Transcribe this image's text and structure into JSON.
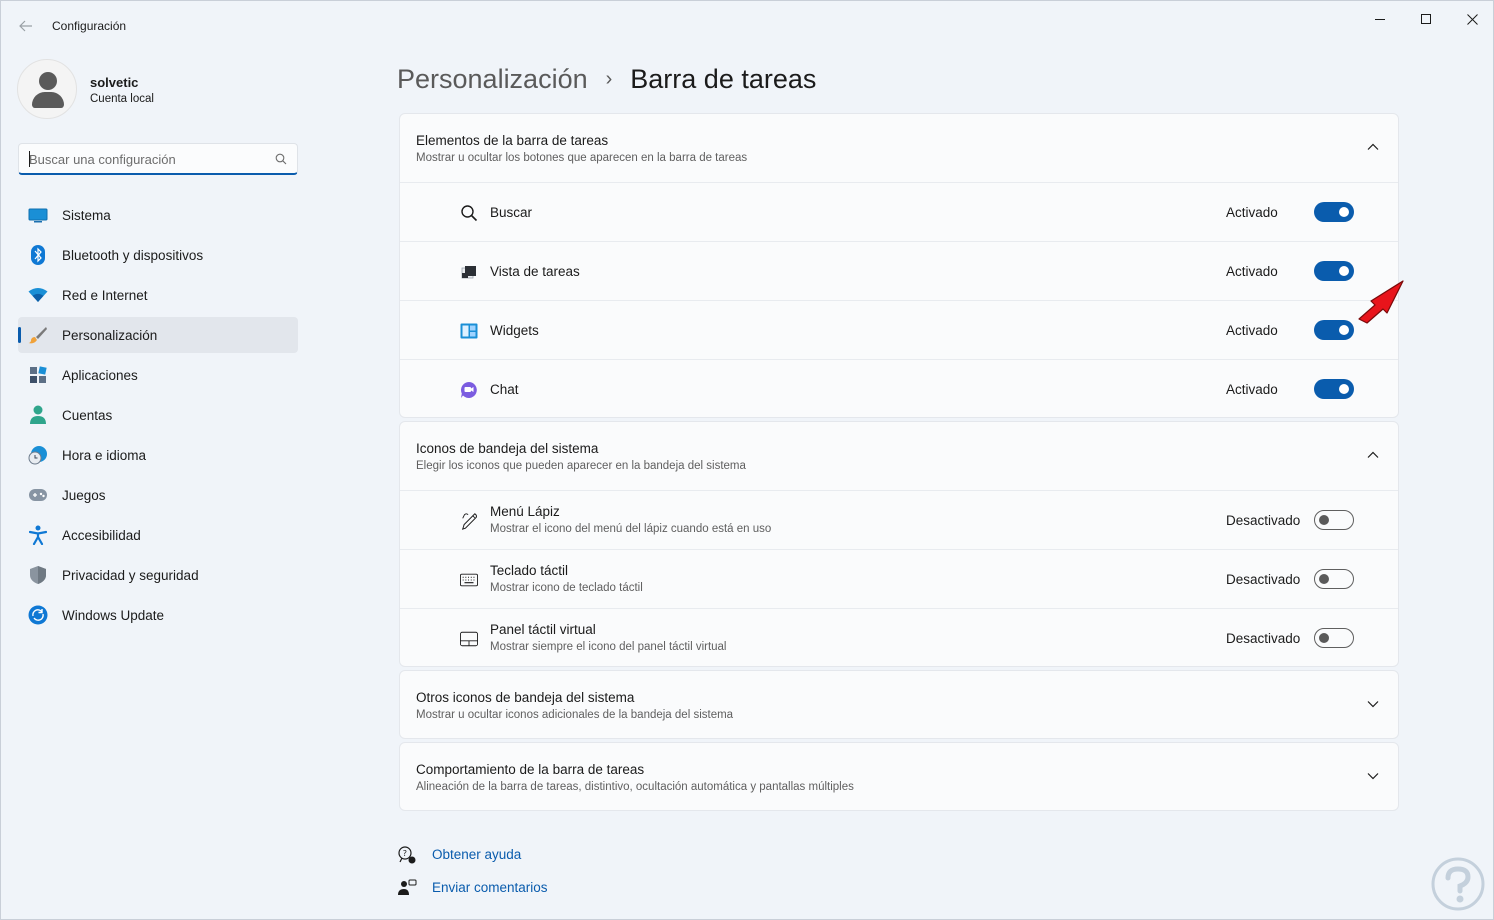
{
  "window": {
    "title": "Configuración",
    "back_icon": "back-arrow-icon",
    "minimize_icon": "minimize-icon",
    "maximize_icon": "maximize-icon",
    "close_icon": "close-icon"
  },
  "profile": {
    "name": "solvetic",
    "account_type": "Cuenta local"
  },
  "search": {
    "placeholder": "Buscar una configuración",
    "value": ""
  },
  "sidebar": {
    "items": [
      {
        "label": "Sistema",
        "icon": "system-icon",
        "active": false
      },
      {
        "label": "Bluetooth y dispositivos",
        "icon": "bluetooth-icon",
        "active": false
      },
      {
        "label": "Red e Internet",
        "icon": "wifi-icon",
        "active": false
      },
      {
        "label": "Personalización",
        "icon": "paintbrush-icon",
        "active": true
      },
      {
        "label": "Aplicaciones",
        "icon": "apps-icon",
        "active": false
      },
      {
        "label": "Cuentas",
        "icon": "person-icon",
        "active": false
      },
      {
        "label": "Hora e idioma",
        "icon": "clock-globe-icon",
        "active": false
      },
      {
        "label": "Juegos",
        "icon": "gamepad-icon",
        "active": false
      },
      {
        "label": "Accesibilidad",
        "icon": "accessibility-icon",
        "active": false
      },
      {
        "label": "Privacidad y seguridad",
        "icon": "shield-icon",
        "active": false
      },
      {
        "label": "Windows Update",
        "icon": "update-icon",
        "active": false
      }
    ]
  },
  "breadcrumb": {
    "parent": "Personalización",
    "separator": "›",
    "current": "Barra de tareas"
  },
  "sections": {
    "taskbar_items": {
      "title": "Elementos de la barra de tareas",
      "description": "Mostrar u ocultar los botones que aparecen en la barra de tareas",
      "expanded": true,
      "rows": [
        {
          "label": "Buscar",
          "state": "Activado",
          "on": true,
          "icon": "search-icon"
        },
        {
          "label": "Vista de tareas",
          "state": "Activado",
          "on": true,
          "icon": "task-view-icon"
        },
        {
          "label": "Widgets",
          "state": "Activado",
          "on": true,
          "icon": "widgets-icon"
        },
        {
          "label": "Chat",
          "state": "Activado",
          "on": true,
          "icon": "chat-icon"
        }
      ]
    },
    "tray_icons": {
      "title": "Iconos de bandeja del sistema",
      "description": "Elegir los iconos que pueden aparecer en la bandeja del sistema",
      "expanded": true,
      "rows": [
        {
          "label": "Menú Lápiz",
          "sub": "Mostrar el icono del menú del lápiz cuando está en uso",
          "state": "Desactivado",
          "on": false,
          "icon": "pen-icon"
        },
        {
          "label": "Teclado táctil",
          "sub": "Mostrar icono de teclado táctil",
          "state": "Desactivado",
          "on": false,
          "icon": "keyboard-icon"
        },
        {
          "label": "Panel táctil virtual",
          "sub": "Mostrar siempre el icono del panel táctil virtual",
          "state": "Desactivado",
          "on": false,
          "icon": "touchpad-icon"
        }
      ]
    },
    "other_tray": {
      "title": "Otros iconos de bandeja del sistema",
      "description": "Mostrar u ocultar iconos adicionales de la bandeja del sistema",
      "expanded": false
    },
    "behavior": {
      "title": "Comportamiento de la barra de tareas",
      "description": "Alineación de la barra de tareas, distintivo, ocultación automática y pantallas múltiples",
      "expanded": false
    }
  },
  "links": {
    "help": "Obtener ayuda",
    "feedback": "Enviar comentarios"
  },
  "colors": {
    "accent": "#0a5cad",
    "background": "#f0f4f9",
    "card": "#fafbfc",
    "annotation_arrow": "#e8141b"
  }
}
